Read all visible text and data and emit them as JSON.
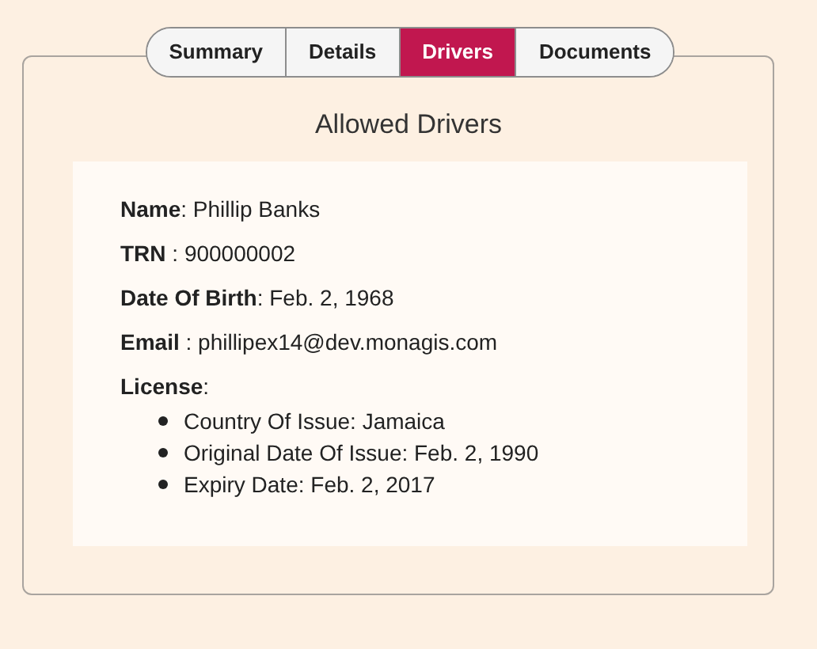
{
  "tabs": [
    {
      "label": "Summary",
      "selected": false
    },
    {
      "label": "Details",
      "selected": false
    },
    {
      "label": "Drivers",
      "selected": true
    },
    {
      "label": "Documents",
      "selected": false
    }
  ],
  "title": "Allowed Drivers",
  "fields": [
    "**Name**: Phillip Banks",
    "**TRN** : 900000002",
    "**Date Of Birth**: Feb. 2, 1968",
    "**Email** : phillipex14@dev.monagis.com"
  ],
  "license": {
    "heading": "**License**:",
    "items": [
      "Country Of Issue: Jamaica",
      "Original Date Of Issue: Feb. 2, 1990",
      "Expiry Date: Feb. 2, 2017"
    ]
  }
}
